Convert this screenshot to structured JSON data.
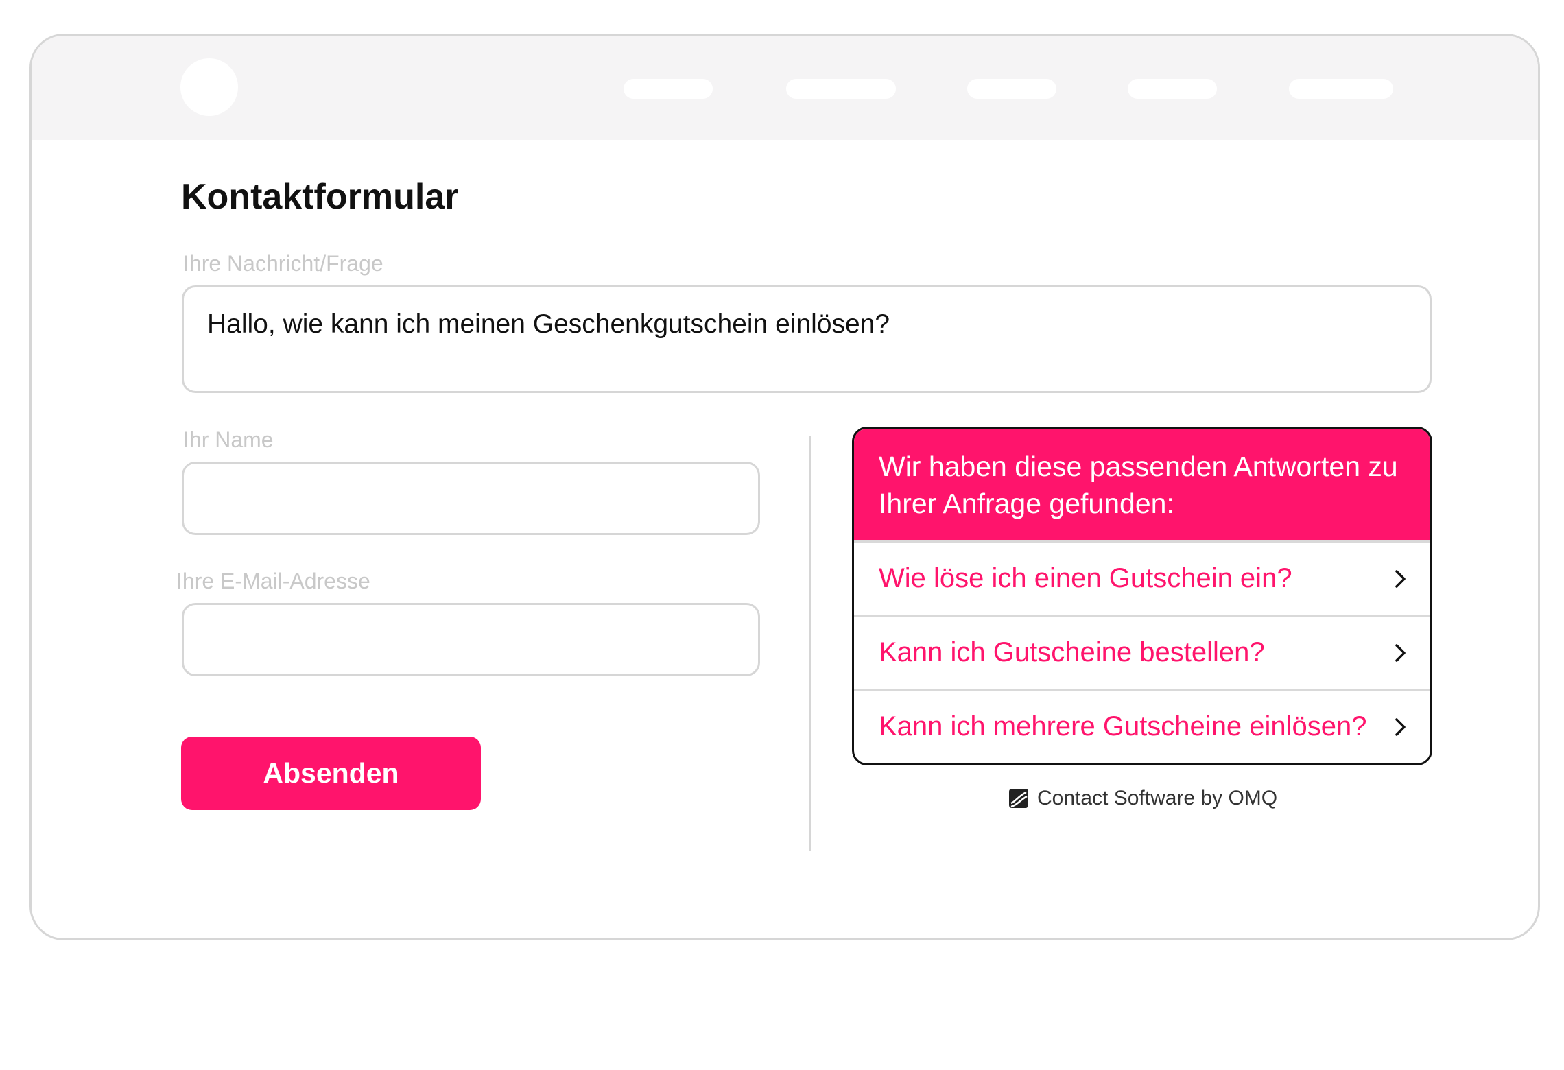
{
  "page": {
    "title": "Kontaktformular"
  },
  "form": {
    "message_label": "Ihre Nachricht/Frage",
    "message_value": "Hallo, wie kann ich meinen Geschenkgutschein einlösen?",
    "name_label": "Ihr Name",
    "name_value": "",
    "email_label": "Ihre E-Mail-Adresse",
    "email_value": "",
    "submit_label": "Absenden"
  },
  "answers": {
    "header": "Wir haben diese passenden Antworten zu Ihrer Anfrage gefunden:",
    "items": [
      {
        "label": "Wie löse ich einen Gutschein ein?",
        "icon": "chevron-right-icon"
      },
      {
        "label": "Kann ich Gutscheine bestellen?",
        "icon": "chevron-right-icon"
      },
      {
        "label": "Kann ich mehrere Gutscheine einlösen?",
        "icon": "chevron-right-icon"
      }
    ]
  },
  "footer": {
    "powered_by": "Contact Software by OMQ",
    "icon": "omq-logo-icon"
  },
  "colors": {
    "accent": "#ff146c",
    "topbar": "#f5f4f5",
    "border": "#d6d6d6",
    "label": "#c8c8c8"
  }
}
